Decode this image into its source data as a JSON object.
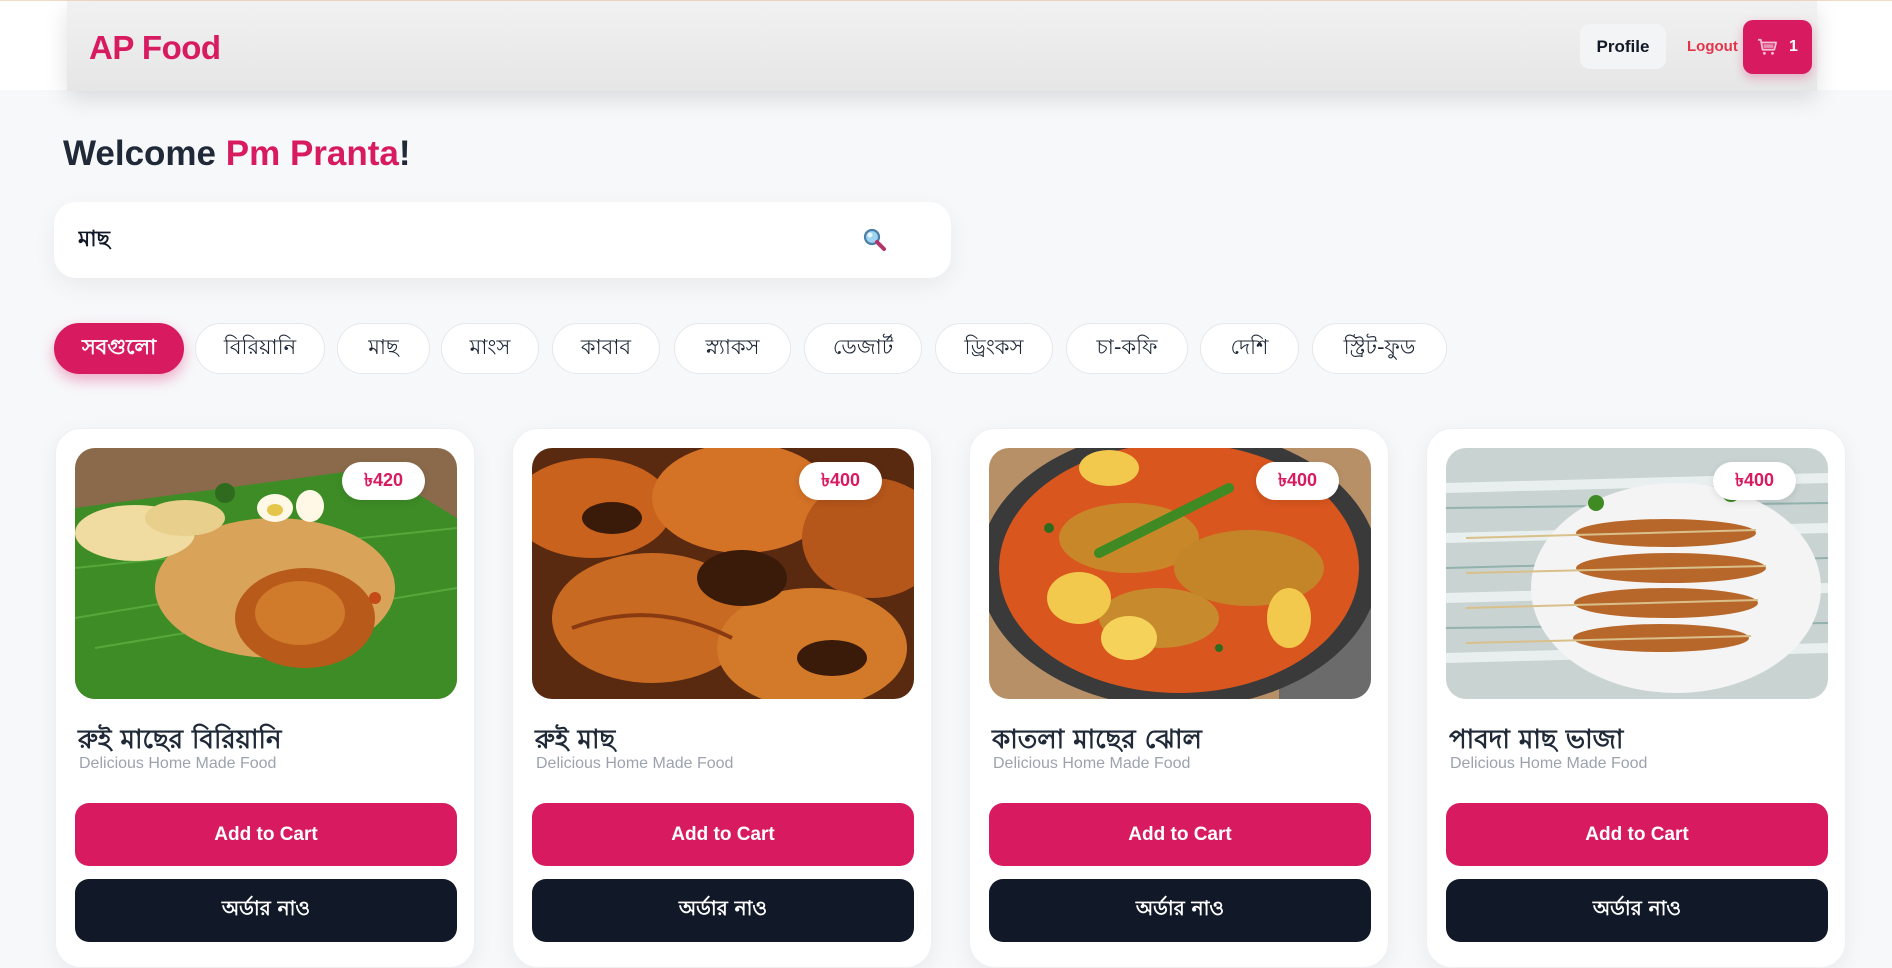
{
  "header": {
    "logo": "AP Food",
    "profile_label": "Profile",
    "logout_label": "Logout",
    "cart_count": "1"
  },
  "welcome": {
    "prefix": "Welcome ",
    "name": "Pm Pranta",
    "suffix": "!"
  },
  "search": {
    "value": "মাছ"
  },
  "categories": [
    {
      "label": "সবগুলো",
      "active": true
    },
    {
      "label": "বিরিয়ানি",
      "active": false
    },
    {
      "label": "মাছ",
      "active": false
    },
    {
      "label": "মাংস",
      "active": false
    },
    {
      "label": "কাবাব",
      "active": false
    },
    {
      "label": "স্ন্যাকস",
      "active": false
    },
    {
      "label": "ডেজার্ট",
      "active": false
    },
    {
      "label": "ড্রিংকস",
      "active": false
    },
    {
      "label": "চা-কফি",
      "active": false
    },
    {
      "label": "দেশি",
      "active": false
    },
    {
      "label": "স্ট্রিট-ফুড",
      "active": false
    }
  ],
  "products": [
    {
      "name": "রুই মাছের বিরিয়ানি",
      "subtitle": "Delicious Home Made Food",
      "price": "৳420",
      "add_label": "Add to Cart",
      "order_label": "অর্ডার নাও"
    },
    {
      "name": "রুই মাছ",
      "subtitle": "Delicious Home Made Food",
      "price": "৳400",
      "add_label": "Add to Cart",
      "order_label": "অর্ডার নাও"
    },
    {
      "name": "কাতলা মাছের ঝোল",
      "subtitle": "Delicious Home Made Food",
      "price": "৳400",
      "add_label": "Add to Cart",
      "order_label": "অর্ডার নাও"
    },
    {
      "name": "পাবদা মাছ ভাজা",
      "subtitle": "Delicious Home Made Food",
      "price": "৳400",
      "add_label": "Add to Cart",
      "order_label": "অর্ডার নাও"
    }
  ],
  "colors": {
    "brand": "#d81b60",
    "dark": "#111827",
    "background": "#f7f8fa"
  }
}
